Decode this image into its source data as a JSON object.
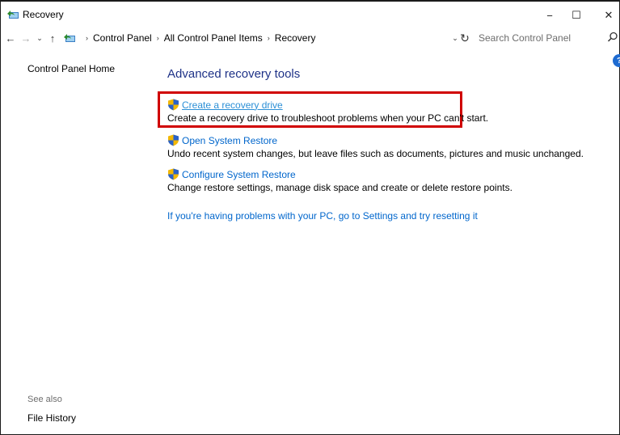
{
  "window": {
    "title": "Recovery",
    "minimize": "−",
    "maximize": "☐",
    "close": "✕"
  },
  "nav": {
    "back": "←",
    "forward": "→",
    "recent": "⌄",
    "up": "↑",
    "breadcrumbs": [
      "Control Panel",
      "All Control Panel Items",
      "Recovery"
    ],
    "separator": "›",
    "dropdown": "⌄",
    "refresh": "↻"
  },
  "search": {
    "placeholder": "Search Control Panel"
  },
  "sidebar": {
    "home": "Control Panel Home",
    "see_also": "See also",
    "file_history": "File History"
  },
  "help": "?",
  "main": {
    "heading": "Advanced recovery tools",
    "tasks": [
      {
        "link": "Create a recovery drive",
        "description": "Create a recovery drive to troubleshoot problems when your PC can't start."
      },
      {
        "link": "Open System Restore",
        "description": "Undo recent system changes, but leave files such as documents, pictures and music unchanged."
      },
      {
        "link": "Configure System Restore",
        "description": "Change restore settings, manage disk space and create or delete restore points."
      }
    ],
    "reset_link": "If you're having problems with your PC, go to Settings and try resetting it"
  },
  "colors": {
    "link": "#0066cc",
    "heading": "#1e3287",
    "highlight": "#d00000"
  }
}
